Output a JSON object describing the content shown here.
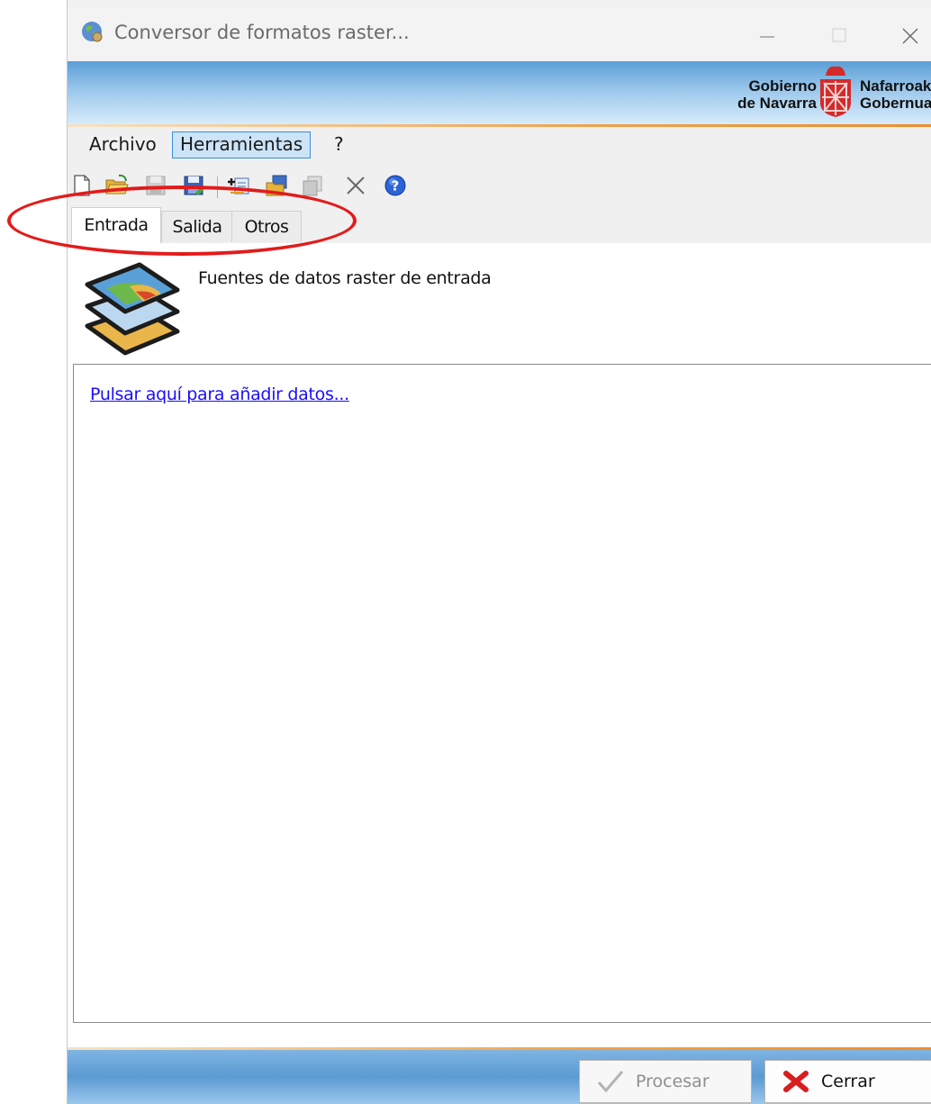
{
  "window": {
    "title": "Conversor de formatos raster...",
    "controls": {
      "minimize": "—",
      "maximize": "☐",
      "close": "✕"
    }
  },
  "banner": {
    "logo_left_line1": "Gobierno",
    "logo_left_line2": "de Navarra",
    "logo_right_line1": "Nafarroak",
    "logo_right_line2": "Gobernua"
  },
  "menu": {
    "items": [
      {
        "label": "Archivo",
        "active": false
      },
      {
        "label": "Herramientas",
        "active": true
      },
      {
        "label": "?",
        "active": false
      }
    ]
  },
  "toolbar": {
    "icons": [
      "new-file-icon",
      "open-folder-icon",
      "save-disabled-icon",
      "save-as-icon",
      "add-layer-icon",
      "folder-layers-icon",
      "copy-disabled-icon",
      "delete-icon",
      "help-icon"
    ]
  },
  "tabs": [
    {
      "label": "Entrada",
      "selected": true
    },
    {
      "label": "Salida",
      "selected": false
    },
    {
      "label": "Otros",
      "selected": false
    }
  ],
  "input_page": {
    "description": "Fuentes de datos raster de entrada",
    "add_link": "Pulsar aquí para añadir datos..."
  },
  "buttons": {
    "process": {
      "label": "Procesar",
      "enabled": false
    },
    "close": {
      "label": "Cerrar",
      "enabled": true
    }
  },
  "colors": {
    "accent_blue": "#3d8fd6",
    "annotation_red": "#e31b1b",
    "link_blue": "#1a0dff",
    "banner_orange": "#ef8d2a"
  }
}
